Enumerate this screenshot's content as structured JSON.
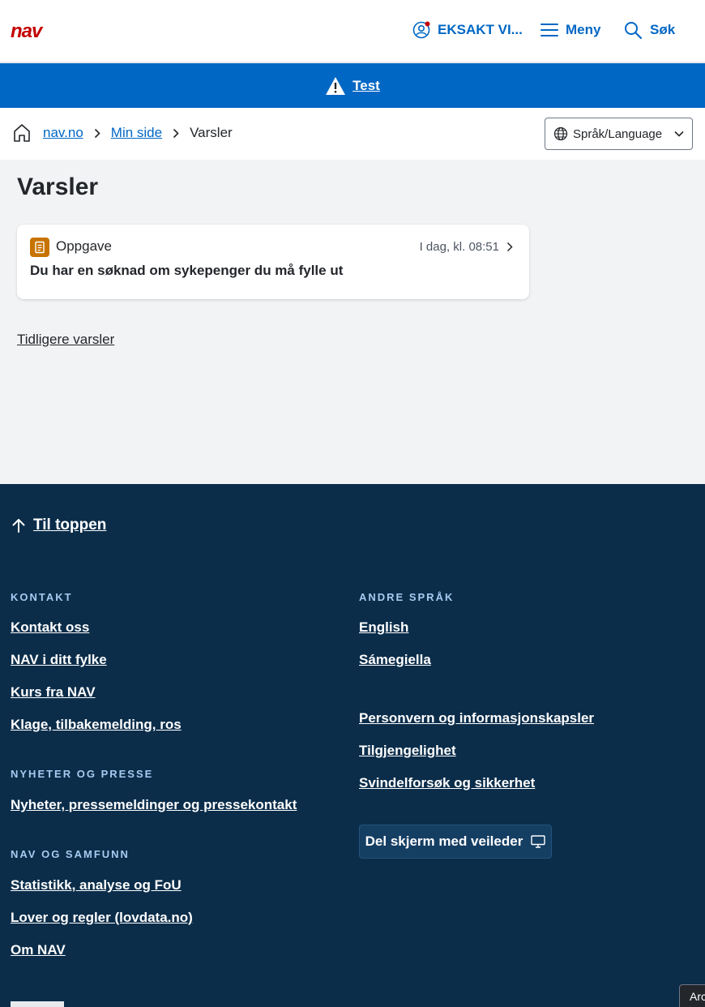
{
  "header": {
    "user_label": "EKSAKT VI...",
    "menu_label": "Meny",
    "search_label": "Søk",
    "accent": "#0067c5",
    "brand_red": "#c30000"
  },
  "banner": {
    "label": "Test"
  },
  "breadcrumb": {
    "items": [
      "nav.no",
      "Min side"
    ],
    "current": "Varsler"
  },
  "language": {
    "label": "Språk/Language"
  },
  "main": {
    "title": "Varsler",
    "notifications": [
      {
        "tag": "Oppgave",
        "time": "I dag, kl. 08:51",
        "message": "Du har en søknad om sykepenger du må fylle ut"
      }
    ],
    "older_link": "Tidligere varsler"
  },
  "footer": {
    "to_top": "Til toppen",
    "sections": {
      "kontakt": {
        "heading": "KONTAKT",
        "links": [
          "Kontakt oss",
          "NAV i ditt fylke",
          "Kurs fra NAV",
          "Klage, tilbakemelding, ros"
        ]
      },
      "presse": {
        "heading": "NYHETER OG PRESSE",
        "links": [
          "Nyheter, pressemeldinger og pressekontakt"
        ]
      },
      "samfunn": {
        "heading": "NAV OG SAMFUNN",
        "links": [
          "Statistikk, analyse og FoU",
          "Lover og regler (lovdata.no)",
          "Om NAV"
        ]
      },
      "sprak": {
        "heading": "ANDRE SPRÅK",
        "links": [
          "English",
          "Sámegiella"
        ]
      },
      "other": {
        "links": [
          "Personvern og informasjonskapsler",
          "Tilgjengelighet",
          "Svindelforsøk og sikkerhet"
        ]
      }
    },
    "share_button": "Del skjerm med veileder",
    "corner_label": "Arc"
  }
}
